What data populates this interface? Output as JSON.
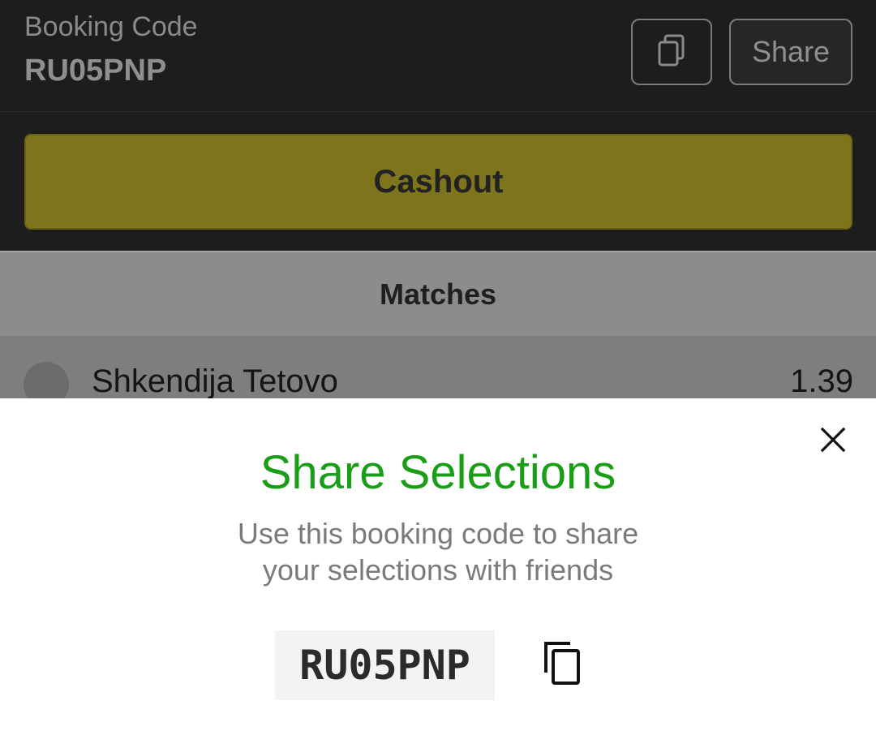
{
  "header": {
    "booking_label": "Booking Code",
    "booking_code": "RU05PNP",
    "copy_icon": "copy-icon",
    "share_label": "Share"
  },
  "cashout": {
    "label": "Cashout"
  },
  "matches": {
    "heading": "Matches",
    "rows": [
      {
        "name": "Shkendija Tetovo",
        "odds": "1.39"
      }
    ]
  },
  "share_sheet": {
    "title": "Share Selections",
    "description_line1": "Use this booking code to share",
    "description_line2": "your selections with friends",
    "code": "RU05PNP",
    "close_icon": "close-icon",
    "copy_icon": "copy-icon"
  },
  "colors": {
    "title_green": "#1a9e18",
    "cashout_olive": "#7d741c",
    "header_dark": "#1d1d1d"
  }
}
